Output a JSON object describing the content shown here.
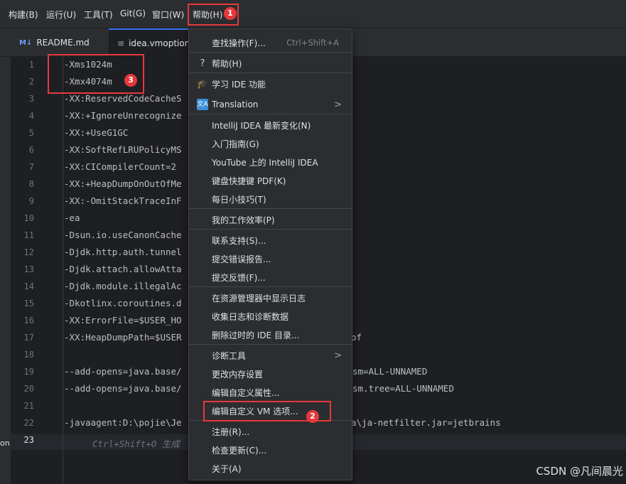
{
  "menubar": {
    "items": [
      "构建(B)",
      "运行(U)",
      "工具(T)",
      "Git(G)",
      "窗口(W)",
      "帮助(H)"
    ]
  },
  "tabs": [
    {
      "icon": "M↓",
      "label": "README.md"
    },
    {
      "icon": "≡",
      "label": "idea.vmoption"
    }
  ],
  "editor": {
    "line_numbers": [
      "1",
      "2",
      "3",
      "4",
      "5",
      "6",
      "7",
      "8",
      "9",
      "10",
      "11",
      "12",
      "13",
      "14",
      "15",
      "16",
      "17",
      "18",
      "19",
      "20",
      "21",
      "22",
      "23"
    ],
    "current_line": "23",
    "lines": [
      "-Xms1024m",
      "-Xmx4074m",
      "-XX:ReservedCodeCacheS",
      "-XX:+IgnoreUnrecognize",
      "-XX:+UseG1GC",
      "-XX:SoftRefLRUPolicyMS",
      "-XX:CICompilerCount=2",
      "-XX:+HeapDumpOnOutOfMe",
      "-XX:-OmitStackTraceInF",
      "-ea",
      "-Dsun.io.useCanonCache",
      "-Djdk.http.auth.tunnel",
      "-Djdk.attach.allowAtta",
      "-Djdk.module.illegalAc",
      "-Dkotlinx.coroutines.d",
      "-XX:ErrorFile=$USER_HO",
      "-XX:HeapDumpPath=$USER",
      "",
      "--add-opens=java.base/",
      "--add-opens=java.base/",
      "",
      "-javaagent:D:\\pojie\\Je",
      ""
    ],
    "line_tails": [
      {
        "line": 17,
        "text": "of"
      },
      {
        "line": 19,
        "text": "sm=ALL-UNNAMED"
      },
      {
        "line": 20,
        "text": "sm.tree=ALL-UNNAMED"
      },
      {
        "line": 22,
        "text": "a\\ja-netfilter.jar=jetbrains"
      }
    ],
    "hint": "Ctrl+Shift+O 生成"
  },
  "help_menu": {
    "items": [
      {
        "label": "查找操作(F)...",
        "shortcut": "Ctrl+Shift+A",
        "icon": ""
      },
      {
        "label": "帮助(H)",
        "shortcut": "",
        "icon": "?"
      },
      {
        "label": "学习 IDE 功能",
        "shortcut": "",
        "icon": "🎓"
      },
      {
        "label": "Translation",
        "shortcut": "",
        "icon": "文A",
        "submenu": ">"
      },
      {
        "label": "IntelliJ IDEA 最新变化(N)",
        "shortcut": "",
        "icon": ""
      },
      {
        "label": "入门指南(G)",
        "shortcut": "",
        "icon": ""
      },
      {
        "label": "YouTube 上的 IntelliJ IDEA",
        "shortcut": "",
        "icon": ""
      },
      {
        "label": "键盘快捷键 PDF(K)",
        "shortcut": "",
        "icon": ""
      },
      {
        "label": "每日小技巧(T)",
        "shortcut": "",
        "icon": ""
      },
      {
        "label": "我的工作效率(P)",
        "shortcut": "",
        "icon": ""
      },
      {
        "label": "联系支持(S)...",
        "shortcut": "",
        "icon": ""
      },
      {
        "label": "提交错误报告...",
        "shortcut": "",
        "icon": ""
      },
      {
        "label": "提交反馈(F)...",
        "shortcut": "",
        "icon": ""
      },
      {
        "label": "在资源管理器中显示日志",
        "shortcut": "",
        "icon": ""
      },
      {
        "label": "收集日志和诊断数据",
        "shortcut": "",
        "icon": ""
      },
      {
        "label": "删除过时的 IDE 目录...",
        "shortcut": "",
        "icon": ""
      },
      {
        "label": "诊断工具",
        "shortcut": "",
        "icon": "",
        "submenu": ">"
      },
      {
        "label": "更改内存设置",
        "shortcut": "",
        "icon": ""
      },
      {
        "label": "编辑自定义属性...",
        "shortcut": "",
        "icon": ""
      },
      {
        "label": "编辑自定义 VM 选项...",
        "shortcut": "",
        "icon": ""
      },
      {
        "label": "注册(R)...",
        "shortcut": "",
        "icon": ""
      },
      {
        "label": "检查更新(C)...",
        "shortcut": "",
        "icon": ""
      },
      {
        "label": "关于(A)",
        "shortcut": "",
        "icon": ""
      }
    ]
  },
  "annotations": {
    "badge1": "1",
    "badge2": "2",
    "badge3": "3"
  },
  "left_stub": "on",
  "watermark": "CSDN @凡间晨光",
  "colors": {
    "accent": "#3574f0",
    "annotation_red": "#e4393c",
    "background": "#1e1f22",
    "panel": "#2b2d30"
  }
}
